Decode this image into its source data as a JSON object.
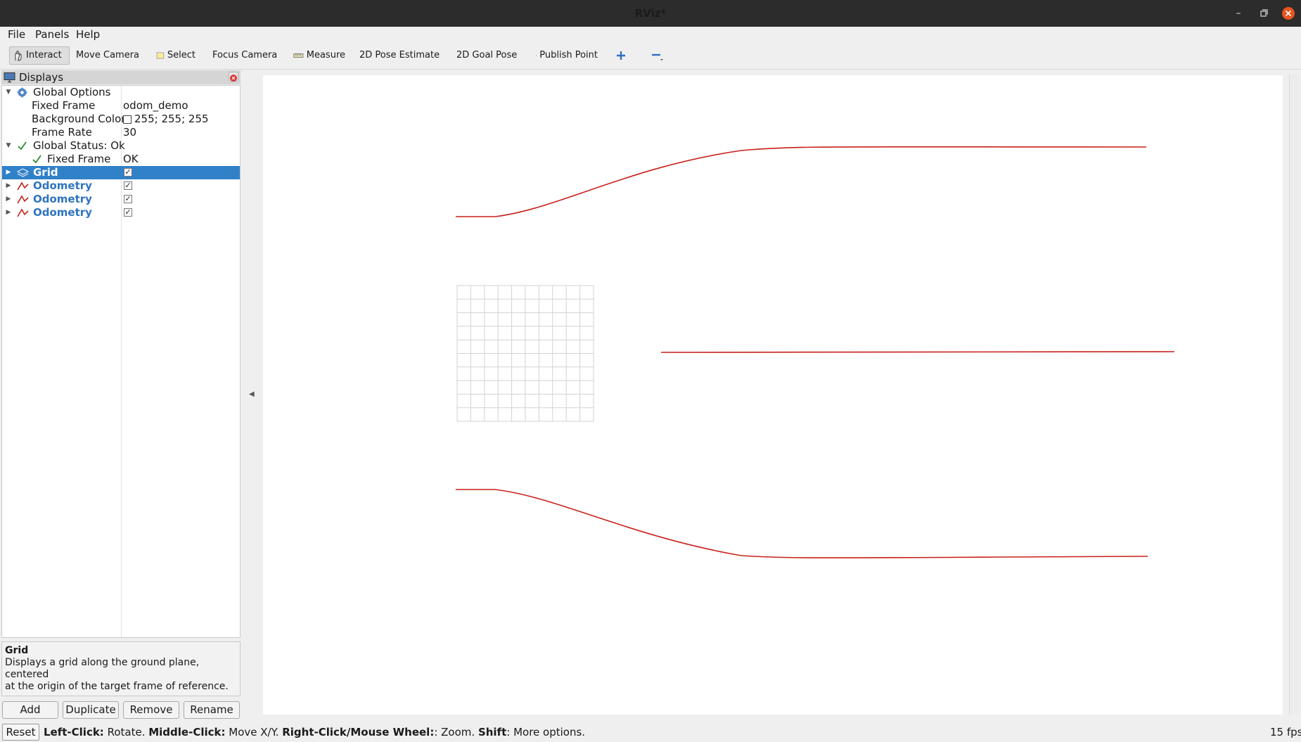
{
  "window": {
    "title": "RViz*",
    "controls": [
      "minimize-icon",
      "maximize-icon",
      "close-icon"
    ],
    "close_color": "#e95420"
  },
  "menu": {
    "file": "File",
    "panels": "Panels",
    "help": "Help"
  },
  "toolbar": {
    "interact": "Interact",
    "move_camera": "Move Camera",
    "select": "Select",
    "focus_camera": "Focus Camera",
    "measure": "Measure",
    "pose_estimate": "2D Pose Estimate",
    "goal_pose": "2D Goal Pose",
    "publish_point": "Publish Point"
  },
  "displays": {
    "title": "Displays",
    "global_options": {
      "label": "Global Options",
      "fixed_frame_label": "Fixed Frame",
      "fixed_frame_value": "odom_demo",
      "background_color_label": "Background Color",
      "background_color_value": "255; 255; 255",
      "frame_rate_label": "Frame Rate",
      "frame_rate_value": "30"
    },
    "global_status": {
      "label": "Global Status: Ok",
      "fixed_frame_label": "Fixed Frame",
      "fixed_frame_value": "OK"
    },
    "items": [
      {
        "label": "Grid",
        "checked": true,
        "selected": true
      },
      {
        "label": "Odometry",
        "checked": true,
        "selected": false
      },
      {
        "label": "Odometry",
        "checked": true,
        "selected": false
      },
      {
        "label": "Odometry",
        "checked": true,
        "selected": false
      }
    ],
    "accent_color": "#3081c8",
    "odometry_color": "#c8201a"
  },
  "description": {
    "title": "Grid",
    "line1": "Displays a grid along the ground plane, centered",
    "line2": "at the origin of the target frame of reference."
  },
  "buttons": {
    "add": "Add",
    "duplicate": "Duplicate",
    "remove": "Remove",
    "rename": "Rename"
  },
  "status": {
    "reset": "Reset",
    "left_click": "Left-Click:",
    "left_click_action": " Rotate. ",
    "middle_click": "Middle-Click:",
    "middle_click_action": " Move X/Y. ",
    "right_click": "Right-Click/Mouse Wheel:",
    "right_click_action": ": Zoom. ",
    "shift": "Shift",
    "shift_action": ": More options.",
    "fps": "15 fps"
  }
}
